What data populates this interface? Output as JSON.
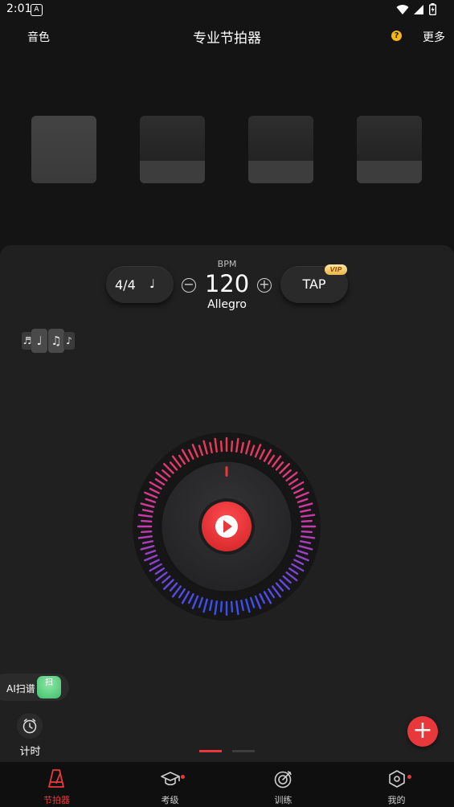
{
  "status_bar": {
    "time": "2:01",
    "app_badge": "A"
  },
  "header": {
    "left_label": "音色",
    "title": "专业节拍器",
    "help_icon": "?",
    "right_label": "更多"
  },
  "beat_blocks": {
    "count": 4,
    "first_is_accent": true
  },
  "controls": {
    "time_signature": "4/4",
    "note_value_icon": "♩",
    "bpm_label": "BPM",
    "bpm_value": "120",
    "tempo_name": "Allegro",
    "decrease_icon": "−",
    "increase_icon": "+",
    "tap_label": "TAP",
    "vip_badge": "VIP"
  },
  "rhythm_selector": {
    "cards": [
      "♬",
      "♩",
      "♫",
      "♪"
    ]
  },
  "ai_scan": {
    "label": "AI扫谱",
    "badge_text": "扫"
  },
  "timer": {
    "label": "计时"
  },
  "fab": {
    "icon": "+"
  },
  "pager": {
    "pages": 2,
    "active": 0
  },
  "colors": {
    "accent": "#e8383c",
    "ring_top": "#ea3a5a",
    "ring_bottom": "#3b4ff0",
    "vip": "#f2c866"
  },
  "tabs": [
    {
      "label": "节拍器",
      "icon": "metronome-icon",
      "active": true,
      "badge": false
    },
    {
      "label": "考级",
      "icon": "graduation-cap-icon",
      "active": false,
      "badge": true
    },
    {
      "label": "训练",
      "icon": "target-icon",
      "active": false,
      "badge": false
    },
    {
      "label": "我的",
      "icon": "hexagon-settings-icon",
      "active": false,
      "badge": true
    }
  ]
}
